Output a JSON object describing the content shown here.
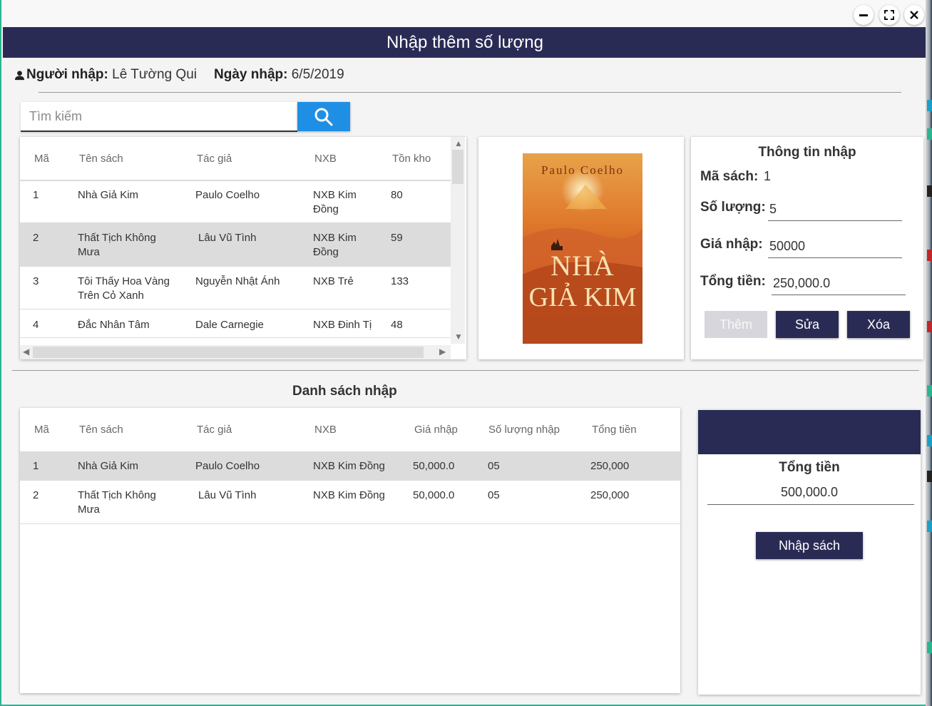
{
  "window": {
    "title": "Nhập thêm số lượng",
    "controls": [
      "minimize-icon",
      "maximize-icon",
      "close-icon"
    ]
  },
  "importer": {
    "user_label": "Người nhập:",
    "user_value": "Lê Tường Qui",
    "date_label": "Ngày nhập:",
    "date_value": "6/5/2019"
  },
  "search": {
    "placeholder": "Tìm kiếm",
    "value": "",
    "button_icon": "search-icon"
  },
  "book_table": {
    "columns": [
      "Mã",
      "Tên sách",
      "Tác giả",
      "NXB",
      "Tồn kho"
    ],
    "rows": [
      {
        "id": "1",
        "title": "Nhà Giả Kim",
        "author": "Paulo Coelho",
        "publisher": "NXB Kim Đồng",
        "stock": "80"
      },
      {
        "id": "2",
        "title": "Thất Tịch Không Mưa",
        "author": "Lâu Vũ Tình",
        "publisher": "NXB Kim Đồng",
        "stock": "59"
      },
      {
        "id": "3",
        "title": "Tôi Thấy Hoa Vàng Trên Cỏ Xanh",
        "author": "Nguyễn Nhật Ánh",
        "publisher": "NXB Trẻ",
        "stock": "133"
      },
      {
        "id": "4",
        "title": "Đắc Nhân Tâm",
        "author": "Dale Carnegie",
        "publisher": "NXB Đinh Tị",
        "stock": "48"
      }
    ],
    "selected_row": 2
  },
  "cover": {
    "author": "Paulo Coelho",
    "title_line1": "NHÀ",
    "title_line2": "GIẢ KIM"
  },
  "entry_form": {
    "title": "Thông tin nhập",
    "book_id_label": "Mã sách:",
    "book_id_value": "1",
    "quantity_label": "Số lượng:",
    "quantity_value": "5",
    "price_label": "Giá nhập:",
    "price_value": "50000",
    "total_label": "Tổng tiền:",
    "total_value": "250,000.0",
    "add_label": "Thêm",
    "edit_label": "Sửa",
    "delete_label": "Xóa"
  },
  "import_list": {
    "title": "Danh sách nhập",
    "columns": [
      "Mã",
      "Tên sách",
      "Tác giả",
      "NXB",
      "Giá nhập",
      "Số lượng nhập",
      "Tổng tiền"
    ],
    "rows": [
      {
        "id": "1",
        "title": "Nhà Giả Kim",
        "author": "Paulo Coelho",
        "publisher": "NXB Kim Đồng",
        "price": "50,000.0",
        "qty": "05",
        "total": "250,000"
      },
      {
        "id": "2",
        "title": "Thất Tịch Không Mưa",
        "author": "Lâu Vũ Tình",
        "publisher": "NXB Kim Đồng",
        "price": "50,000.0",
        "qty": "05",
        "total": "250,000"
      }
    ],
    "selected_row": 1
  },
  "summary": {
    "total_label": "Tổng tiền",
    "total_value": "500,000.0",
    "submit_label": "Nhập sách"
  },
  "colors": {
    "header_bg": "#2a2b55",
    "accent_blue": "#1f8fe5",
    "selected_row": "#dcdcdc"
  }
}
